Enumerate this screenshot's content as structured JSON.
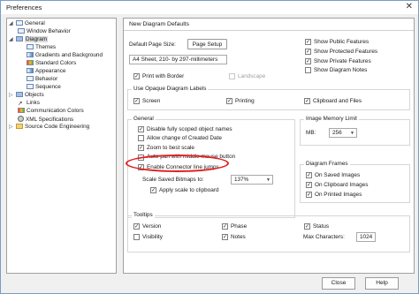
{
  "window": {
    "title": "Preferences",
    "close_glyph": "✕"
  },
  "tree": {
    "items": [
      {
        "label": "General",
        "expander": "◢",
        "icon": "window-icon"
      },
      {
        "label": "Window Behavior",
        "icon": "window-icon"
      },
      {
        "label": "Diagram",
        "expander": "◢",
        "icon": "diagram-icon",
        "selected": true
      },
      {
        "label": "Themes",
        "icon": "window-icon"
      },
      {
        "label": "Gradients and Background",
        "icon": "gradient-icon"
      },
      {
        "label": "Standard Colors",
        "icon": "palette-icon"
      },
      {
        "label": "Appearance",
        "icon": "appearance-icon"
      },
      {
        "label": "Behavior",
        "icon": "window-icon"
      },
      {
        "label": "Sequence",
        "icon": "window-icon"
      },
      {
        "label": "Objects",
        "expander": "▷",
        "icon": "objects-icon"
      },
      {
        "label": "Links",
        "icon": "link-icon"
      },
      {
        "label": "Communication Colors",
        "icon": "palette-icon"
      },
      {
        "label": "XML Specifications",
        "icon": "gear-icon"
      },
      {
        "label": "Source Code Engineering",
        "expander": "▷",
        "icon": "folder-icon"
      }
    ]
  },
  "panel": {
    "title": "New Diagram Defaults",
    "default_page_size_label": "Default Page Size:",
    "page_setup_button": "Page Setup",
    "page_size_value": "A4 Sheet, 210- by 297-millimeters",
    "print_with_border": {
      "label": "Print with Border",
      "checked": true
    },
    "landscape": {
      "label": "Landscape",
      "checked": false,
      "disabled": true
    },
    "right_checks": [
      {
        "label": "Show Public Features",
        "checked": true
      },
      {
        "label": "Show Protected Features",
        "checked": true
      },
      {
        "label": "Show Private Features",
        "checked": true
      },
      {
        "label": "Show Diagram Notes",
        "checked": false
      }
    ],
    "opaque_group": {
      "title": "Use Opaque Diagram Labels",
      "items": [
        {
          "label": "Screen",
          "checked": true
        },
        {
          "label": "Printing",
          "checked": true
        },
        {
          "label": "Clipboard and Files",
          "checked": true
        }
      ]
    },
    "general_group": {
      "title": "General",
      "items": [
        {
          "label": "Disable fully scoped object names",
          "checked": true
        },
        {
          "label": "Allow change of Created Date",
          "checked": false
        },
        {
          "label": "Zoom to best scale",
          "checked": true
        },
        {
          "label": "Auto-pan with middle mouse button",
          "checked": false
        },
        {
          "label": "Enable Connector line jumps",
          "checked": true
        }
      ],
      "scale_label": "Scale Saved Bitmaps to:",
      "scale_value": "137%",
      "apply_scale": {
        "label": "Apply scale to clipboard",
        "checked": true
      }
    },
    "image_memory": {
      "title": "Image Memory Limit",
      "label": "MB:",
      "value": "256"
    },
    "diagram_frames": {
      "title": "Diagram Frames",
      "items": [
        {
          "label": "On Saved Images",
          "checked": true
        },
        {
          "label": "On Clipboard Images",
          "checked": true
        },
        {
          "label": "On Printed Images",
          "checked": true
        }
      ]
    },
    "tooltips": {
      "title": "Tooltips",
      "items": [
        {
          "label": "Version",
          "checked": true
        },
        {
          "label": "Phase",
          "checked": true
        },
        {
          "label": "Status",
          "checked": true
        },
        {
          "label": "Visibility",
          "checked": false
        },
        {
          "label": "Notes",
          "checked": true
        }
      ],
      "max_chars_label": "Max Characters:",
      "max_chars_value": "1024"
    }
  },
  "footer": {
    "close": "Close",
    "help": "Help"
  },
  "annotation": {
    "color": "#e02020"
  }
}
